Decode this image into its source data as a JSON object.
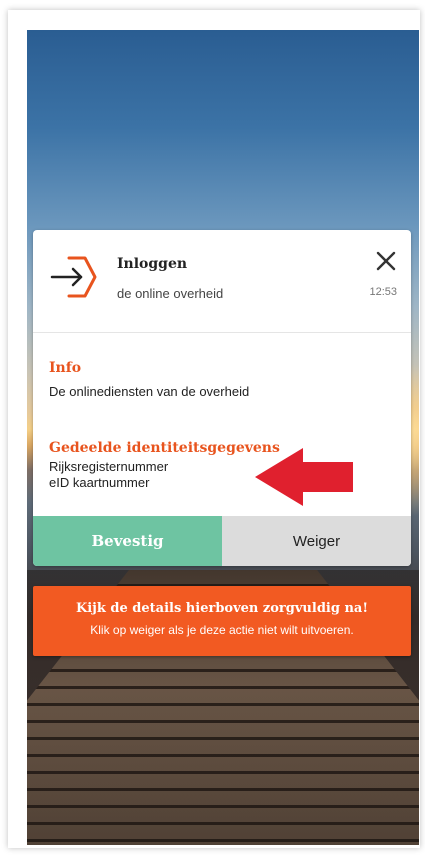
{
  "notification": {
    "app_title": "Inloggen",
    "app_subtitle": "de online overheid",
    "time": "12:53",
    "close_icon": "close-icon",
    "logo_icon": "login-arrow-hexagon-icon"
  },
  "info": {
    "heading": "Info",
    "text": "De onlinediensten van de overheid"
  },
  "shared": {
    "heading": "Gedeelde identiteitsgegevens",
    "items": [
      "Rijksregisternummer",
      "eID kaartnummer"
    ],
    "pointer_icon": "red-arrow-left-icon"
  },
  "buttons": {
    "confirm_label": "Bevestig",
    "refuse_label": "Weiger"
  },
  "warning": {
    "title": "Kijk de details hierboven zorgvuldig na!",
    "text": "Klik op weiger als je deze actie niet wilt uitvoeren."
  },
  "colors": {
    "accent_orange": "#e8541e",
    "warning_bg": "#f25a22",
    "confirm_green": "#6ec4a2",
    "refuse_gray": "#dcdcdc",
    "arrow_red": "#e0202e"
  }
}
